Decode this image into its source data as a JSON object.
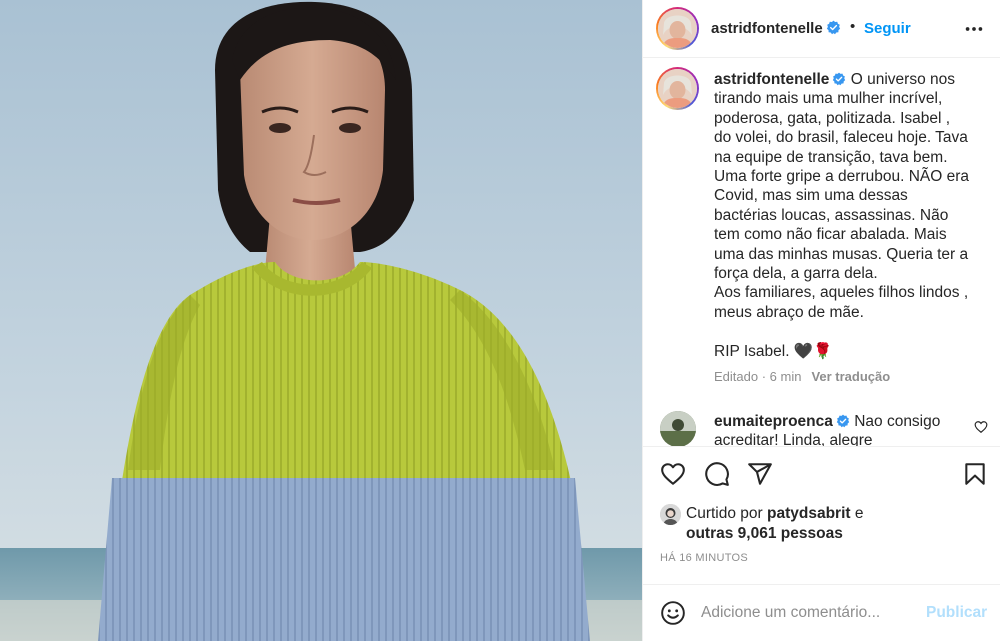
{
  "post": {
    "photo_alt": "",
    "header": {
      "username": "astridfontenelle",
      "separator": "•",
      "follow_label": "Seguir",
      "more_icon": "more-horizontal-icon"
    },
    "caption": {
      "username": "astridfontenelle",
      "text": "O universo nos\ntirando mais uma mulher incrível,\npoderosa, gata, politizada. Isabel ,\ndo volei, do brasil, faleceu hoje. Tava\nna equipe de transição, tava bem.\nUma forte gripe a derrubou. NÃO era\nCovid, mas sim uma dessas\nbactérias loucas, assassinas. Não\ntem como não ficar abalada. Mais\numa das minhas musas. Queria ter a\nforça dela, a garra dela.\nAos familiares, aqueles filhos lindos ,\nmeus abraço de mãe.\n\nRIP Isabel. 🖤🌹",
      "time": "Editado · 6 min",
      "translate_label": "Ver tradução"
    },
    "comments": [
      {
        "username": "eumaiteproenca",
        "text": "Nao consigo acreditar! Linda, alegre"
      }
    ],
    "actions": {
      "like_icon": "heart-icon",
      "comment_icon": "comment-icon",
      "share_icon": "share-icon",
      "save_icon": "bookmark-icon"
    },
    "likes": {
      "prefix": "Curtido por",
      "user": "patydsabrit",
      "conjunction": "e",
      "others": "outras 9,061 pessoas"
    },
    "posted": "HÁ 16 MINUTOS",
    "add_comment": {
      "placeholder": "Adicione um comentário...",
      "publish_label": "Publicar",
      "emoji_icon": "emoji-icon"
    }
  },
  "colors": {
    "accent": "#0095f6",
    "verified": "#3897f0",
    "muted": "#8e8e8e",
    "publish_disabled": "#b2dffc",
    "sweater_top": "#b8c93c",
    "sweater_bottom": "#8fa8cc"
  }
}
